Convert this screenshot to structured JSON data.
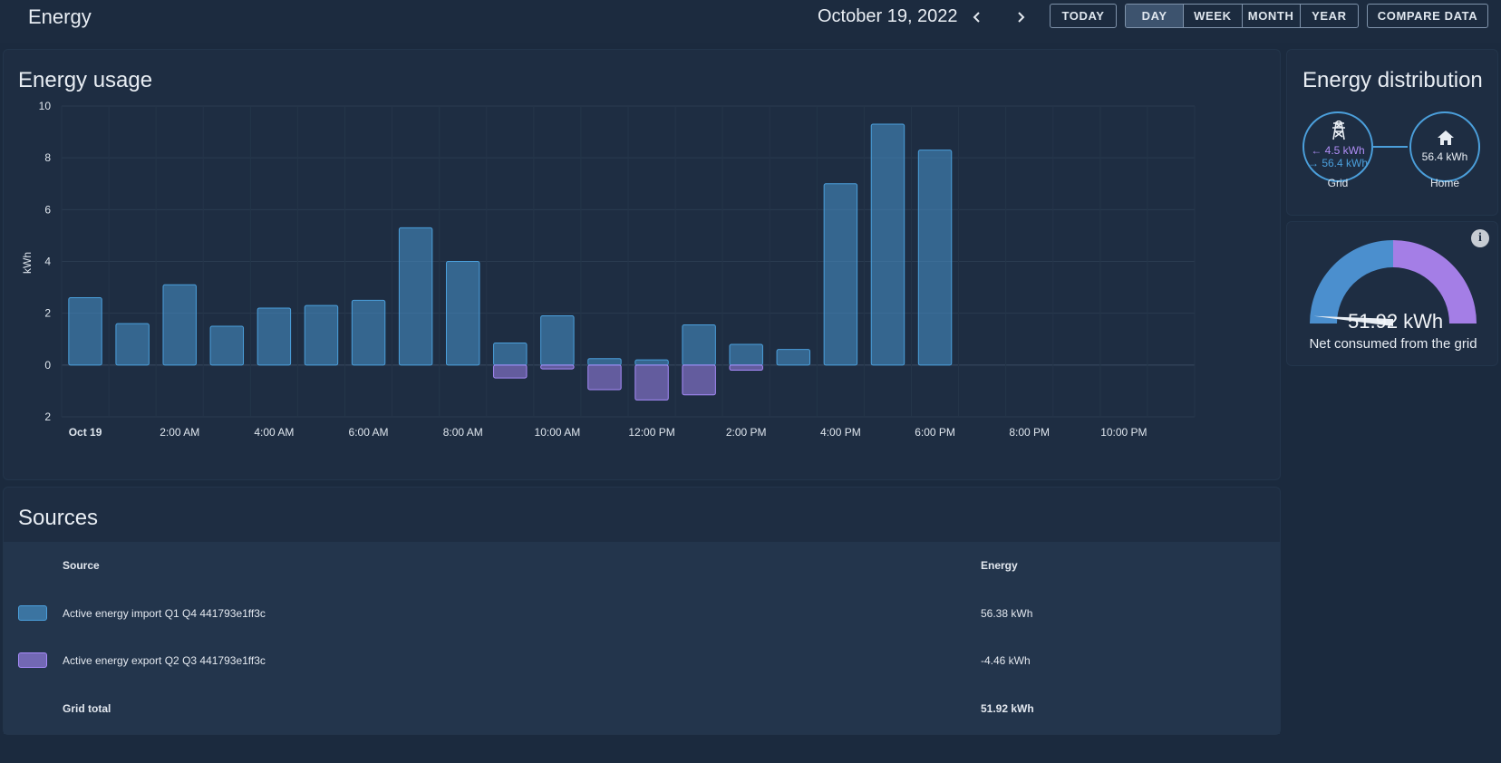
{
  "header": {
    "title": "Energy",
    "date": "October 19, 2022",
    "today_label": "TODAY",
    "periods": [
      "DAY",
      "WEEK",
      "MONTH",
      "YEAR"
    ],
    "active_period": "DAY",
    "compare_label": "COMPARE DATA"
  },
  "usage": {
    "title": "Energy usage"
  },
  "chart_data": {
    "type": "bar",
    "title": "Energy usage",
    "ylabel": "kWh",
    "xlabel": "",
    "ylim": [
      -2,
      10
    ],
    "y_ticks": [
      10,
      8,
      6,
      4,
      2,
      0,
      2
    ],
    "x_tick_labels": [
      "Oct 19",
      "2:00 AM",
      "4:00 AM",
      "6:00 AM",
      "8:00 AM",
      "10:00 AM",
      "12:00 PM",
      "2:00 PM",
      "4:00 PM",
      "6:00 PM",
      "8:00 PM",
      "10:00 PM"
    ],
    "categories": [
      "00:00",
      "01:00",
      "02:00",
      "03:00",
      "04:00",
      "05:00",
      "06:00",
      "07:00",
      "08:00",
      "09:00",
      "10:00",
      "11:00",
      "12:00",
      "13:00",
      "14:00",
      "15:00",
      "16:00",
      "17:00",
      "18:00",
      "19:00",
      "20:00",
      "21:00",
      "22:00",
      "23:00"
    ],
    "series": [
      {
        "name": "Active energy import Q1 Q4 441793e1ff3c",
        "color": "#4b9fdb",
        "values": [
          2.6,
          1.6,
          3.1,
          1.5,
          2.2,
          2.3,
          2.5,
          5.3,
          4.0,
          0.85,
          1.9,
          0.25,
          0.2,
          1.55,
          0.8,
          0.6,
          7.0,
          9.3,
          8.3,
          0,
          0,
          0,
          0,
          0
        ]
      },
      {
        "name": "Active energy export Q2 Q3 441793e1ff3c",
        "color": "#a78bfa",
        "values": [
          0,
          0,
          0,
          0,
          0,
          0,
          0,
          0,
          0,
          -0.5,
          -0.15,
          -0.95,
          -1.35,
          -1.15,
          -0.2,
          0,
          0,
          0,
          0,
          0,
          0,
          0,
          0,
          0
        ]
      }
    ],
    "grid": true
  },
  "sources": {
    "title": "Sources",
    "col_source": "Source",
    "col_energy": "Energy",
    "rows": [
      {
        "name": "Active energy import Q1 Q4 441793e1ff3c",
        "energy": "56.38 kWh",
        "color": "#4b9fdb"
      },
      {
        "name": "Active energy export Q2 Q3 441793e1ff3c",
        "energy": "-4.46 kWh",
        "color": "#a78bfa"
      }
    ],
    "total_label": "Grid total",
    "total_value": "51.92 kWh"
  },
  "distribution": {
    "title": "Energy distribution",
    "grid_export": "← 4.5 kWh",
    "grid_import": "→ 56.4 kWh",
    "grid_label": "Grid",
    "home_value": "56.4 kWh",
    "home_label": "Home"
  },
  "gauge": {
    "value": "51.92 kWh",
    "caption": "Net consumed from the grid",
    "import_kwh": 56.38,
    "export_kwh": 4.46,
    "import_color": "#4b8fce",
    "export_color": "#a47ee6"
  }
}
